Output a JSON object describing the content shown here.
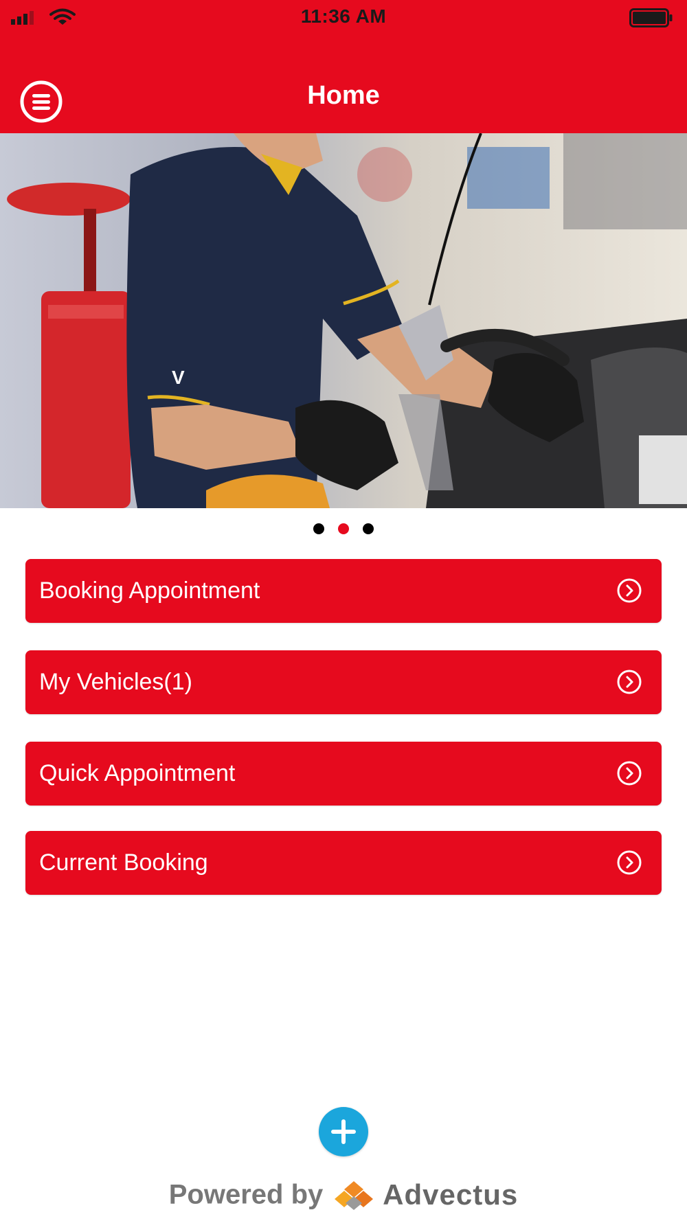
{
  "status_bar": {
    "time": "11:36 AM"
  },
  "header": {
    "title": "Home"
  },
  "carousel": {
    "total": 3,
    "active_index": 1
  },
  "menu": {
    "items": [
      {
        "label": "Booking Appointment"
      },
      {
        "label": "My Vehicles(1)"
      },
      {
        "label": "Quick Appointment"
      },
      {
        "label": "Current Booking"
      }
    ]
  },
  "footer": {
    "powered_by": "Powered by",
    "brand": "Advectus"
  },
  "colors": {
    "accent": "#E60A1E",
    "fab": "#1BA6DC",
    "brand_logo": "#F08A24"
  },
  "icons": {
    "menu": "hamburger-circle-icon",
    "chevron": "chevron-right-circle-icon",
    "add": "plus-icon"
  }
}
